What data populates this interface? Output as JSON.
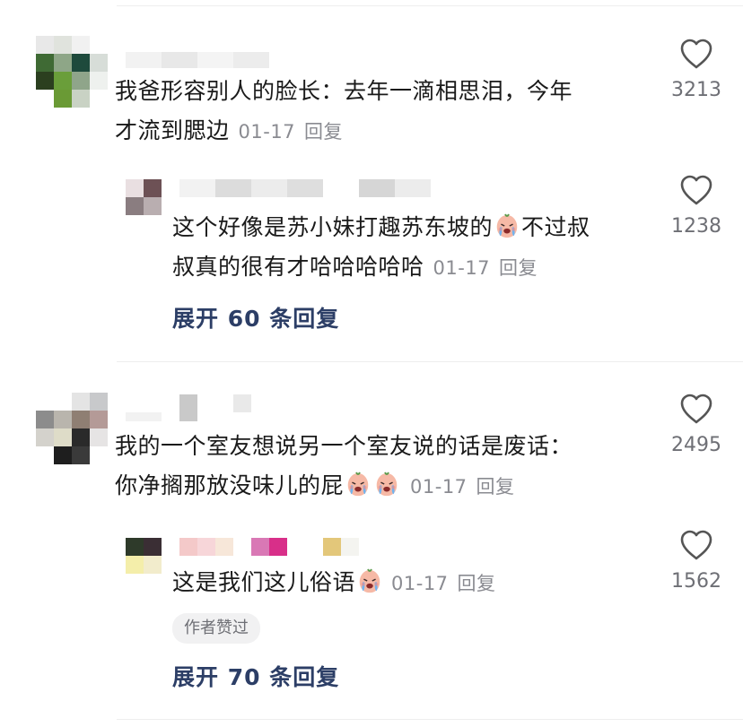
{
  "comments": [
    {
      "text_line1": "我爸形容别人的脸长：去年一滴相思泪，今年",
      "text_line2": "才流到腮边",
      "date": "01-17",
      "reply_label": "回复",
      "likes": "3213",
      "replies": [
        {
          "text_line1": "这个好像是苏小妹打趣苏东坡的",
          "text_line1b": "不过叔",
          "text_line2": "叔真的很有才哈哈哈哈哈",
          "date": "01-17",
          "reply_label": "回复",
          "likes": "1238",
          "emoji": "crying-face-icon"
        }
      ],
      "expand_label": "展开 60 条回复"
    },
    {
      "text_line1": "我的一个室友想说另一个室友说的话是废话：",
      "text_line2": "你净搁那放没味儿的屁",
      "date": "01-17",
      "reply_label": "回复",
      "likes": "2495",
      "replies": [
        {
          "text_line1": "这是我们这儿俗语",
          "date": "01-17",
          "reply_label": "回复",
          "likes": "1562",
          "badge": "作者赞过",
          "emoji": "crying-face-icon"
        }
      ],
      "expand_label": "展开 70 条回复"
    }
  ],
  "colors": {
    "text": "#1a1a1a",
    "meta": "#8a8b91",
    "expand": "#2c3e66",
    "heart_stroke": "#555555"
  }
}
